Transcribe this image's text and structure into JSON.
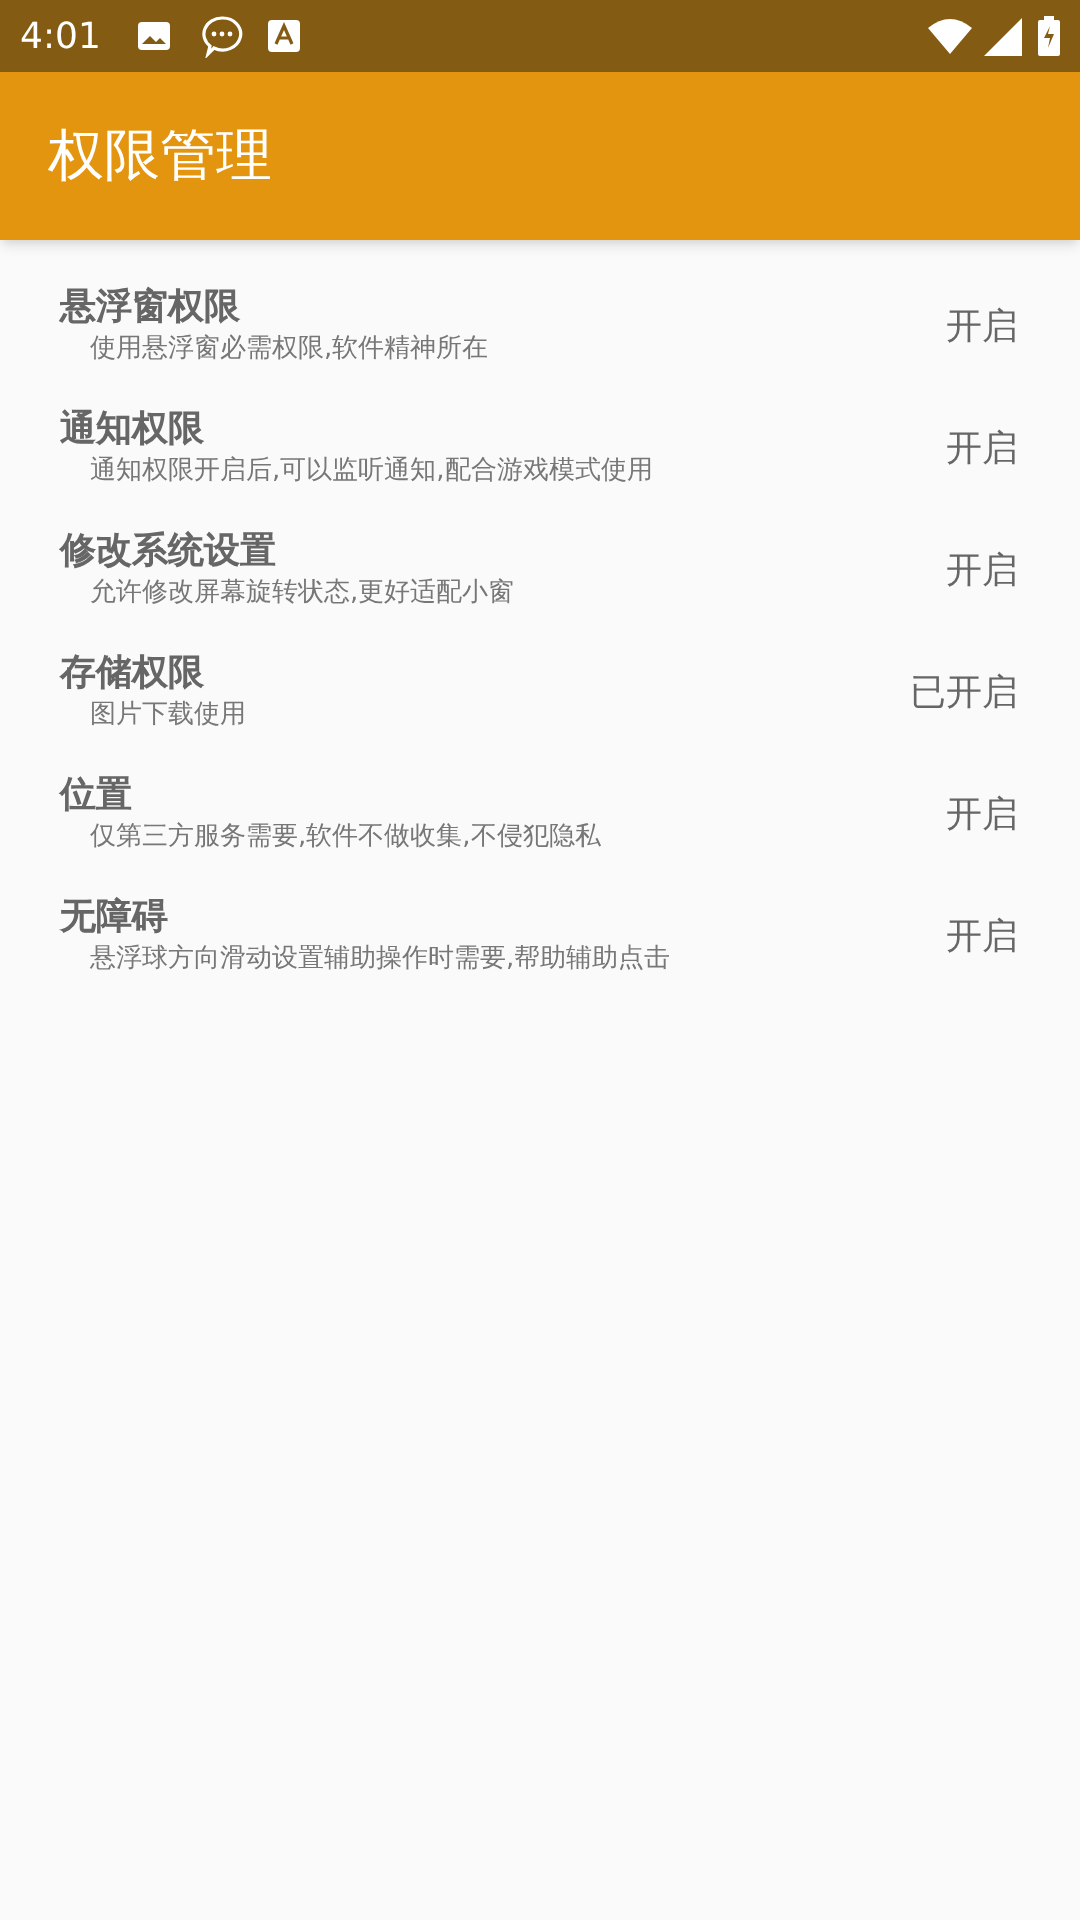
{
  "status_bar": {
    "time": "4:01"
  },
  "app_bar": {
    "title": "权限管理"
  },
  "permissions": [
    {
      "title": "悬浮窗权限",
      "description": "使用悬浮窗必需权限,软件精神所在",
      "action": "开启"
    },
    {
      "title": "通知权限",
      "description": "通知权限开启后,可以监听通知,配合游戏模式使用",
      "action": "开启"
    },
    {
      "title": "修改系统设置",
      "description": "允许修改屏幕旋转状态,更好适配小窗",
      "action": "开启"
    },
    {
      "title": "存储权限",
      "description": "图片下载使用",
      "action": "已开启"
    },
    {
      "title": "位置",
      "description": "仅第三方服务需要,软件不做收集,不侵犯隐私",
      "action": "开启"
    },
    {
      "title": "无障碍",
      "description": "悬浮球方向滑动设置辅助操作时需要,帮助辅助点击",
      "action": "开启"
    }
  ]
}
